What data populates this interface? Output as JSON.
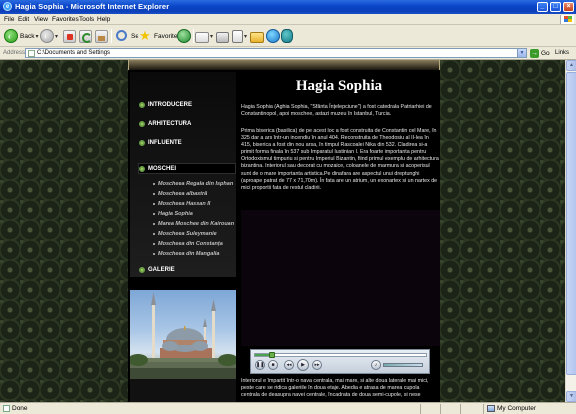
{
  "window": {
    "title": "Hagia Sophia - Microsoft Internet Explorer"
  },
  "menu": [
    "File",
    "Edit",
    "View",
    "Favorites",
    "Tools",
    "Help"
  ],
  "toolbar": {
    "back_label": "Back",
    "search_label": "Search",
    "favorites_label": "Favorites"
  },
  "address": {
    "label": "Address",
    "value": "C:\\Documents and Settings",
    "go_label": "Go",
    "links_label": "Links"
  },
  "nav": {
    "main": [
      {
        "label": "INTRODUCERE"
      },
      {
        "label": "ARHITECTURA"
      },
      {
        "label": "INFLUENTE"
      },
      {
        "label": "MOSCHEI"
      },
      {
        "label": "GALERIE"
      }
    ],
    "sub": [
      "Moscheea Regala din Isphan",
      "Moscheea albastră",
      "Moscheea Hassan II",
      "Hagia Sophia",
      "Marea Moschee din Kairouan",
      "Moscheea Suleymanie",
      "Moscheea din Constanța",
      "Moscheea din Mangalia"
    ]
  },
  "content": {
    "heading": "Hagia Sophia",
    "paragraphs": [
      "Hagia Sophia (Aghia Sophia, \"Sfânta Înțelepciune\") a fost catedrala Patriarhiei de Constantinopol, apoi moschee, astazi muzeu în Istanbul, Turcia.",
      "Prima biserica (basilica) de pe acest loc a fost construita de Constantin cel Mare, în 325 dar a ars într-un incendiu în anul 404. Reconstruita de Theodosiu al II-lea în 415, biserica a fost din nou arsa, în timpul Rascoalei Nika din 532. Cladirea si-a primit forma finala în 537 sub Imparatul Iustinian I. Era foarte importanta pentru Ortodoxismul timpuriu si pentru Imperiul Bizantin, fiind primul exemplu de arhitectura bizantina. Interiorul sau decorat cu mozaice, coloanele de marmura si acoperisul sunt de o mare importanta artistica.Pe dinafara are aspectul unui dreptunghi (aproape patrat de 77 x 71,70m). În fata are un atrium, un exonartex si un nartex de mici proportii fata de restul cladirii.",
      "Interiorul e împartit într-o nava centrala, mai mare, si alte doua laterale mai mici, peste care se ridica galeriile în doua etaje. Abedia e atrasa de marea cupola centrala de deasupra navei centrale, încadrata de doua semi-cupole, si nese"
    ],
    "video_progress": 0.1
  },
  "status": {
    "text": "Done",
    "zone": "My Computer"
  },
  "colors": {
    "titlebar": "#0a46c8",
    "page_bg": "#000000",
    "nav_bullet": "#6aa04a",
    "chrome": "#ece9d8"
  }
}
